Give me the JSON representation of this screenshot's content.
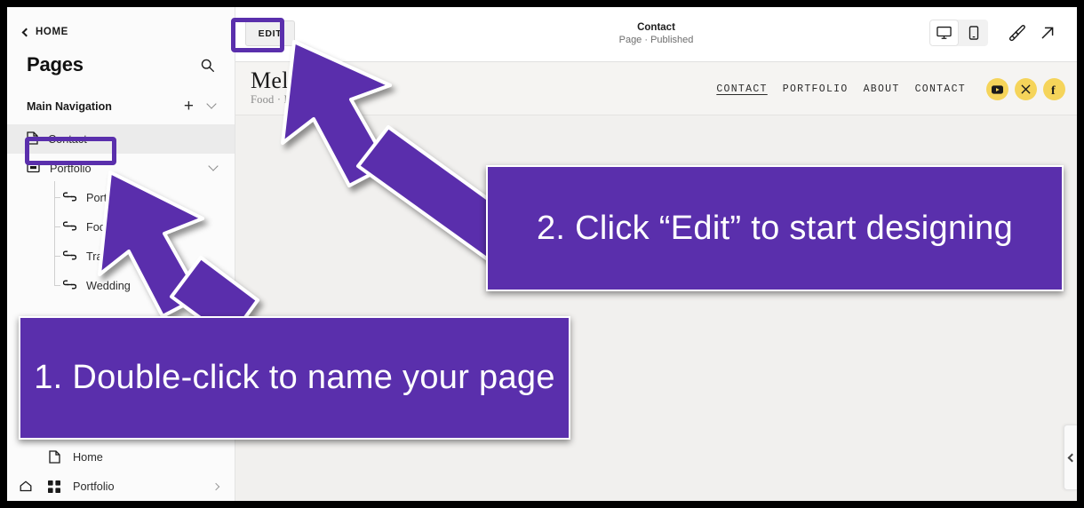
{
  "sidebar": {
    "back_label": "HOME",
    "title": "Pages",
    "search_icon": "search-icon",
    "section": {
      "label": "Main Navigation",
      "add_icon": "plus-icon",
      "collapse_icon": "chevron-down-icon"
    },
    "items": [
      {
        "label": "Contact",
        "icon": "page-icon",
        "selected": true
      },
      {
        "label": "Portfolio",
        "icon": "folder-index-icon",
        "selected": false
      }
    ],
    "sub_items": [
      {
        "label": "Portrait",
        "icon": "link-icon"
      },
      {
        "label": "Food",
        "icon": "link-icon"
      },
      {
        "label": "Travel",
        "icon": "link-icon"
      },
      {
        "label": "Wedding",
        "icon": "link-icon"
      }
    ],
    "footer_items": [
      {
        "label": "Home",
        "icon": "page-icon",
        "lead_icon": "",
        "chevron": false
      },
      {
        "label": "Portfolio",
        "icon": "grid-icon",
        "lead_icon": "home-icon",
        "chevron": true
      }
    ]
  },
  "topbar": {
    "edit_label": "EDIT",
    "page_title": "Contact",
    "page_status": "Page · Published",
    "device_desktop_icon": "desktop-icon",
    "device_mobile_icon": "mobile-icon",
    "style_icon": "paintbrush-icon",
    "open_icon": "external-link-icon"
  },
  "preview": {
    "logo_title": "Melissa S",
    "logo_subtitle": "Food · Portrait · Trav",
    "nav": [
      {
        "label": "CONTACT",
        "active": true
      },
      {
        "label": "PORTFOLIO",
        "active": false
      },
      {
        "label": "ABOUT",
        "active": false
      },
      {
        "label": "CONTACT",
        "active": false
      }
    ],
    "socials": [
      {
        "name": "youtube-icon",
        "glyph": "▶"
      },
      {
        "name": "x-twitter-icon",
        "glyph": "✕"
      },
      {
        "name": "facebook-icon",
        "glyph": "f"
      }
    ],
    "collapse_icon": "chevron-left-icon"
  },
  "annotations": {
    "accent_color": "#5a2fac",
    "callout_1": "1. Double-click to name your page",
    "callout_2": "2. Click “Edit” to start designing"
  }
}
